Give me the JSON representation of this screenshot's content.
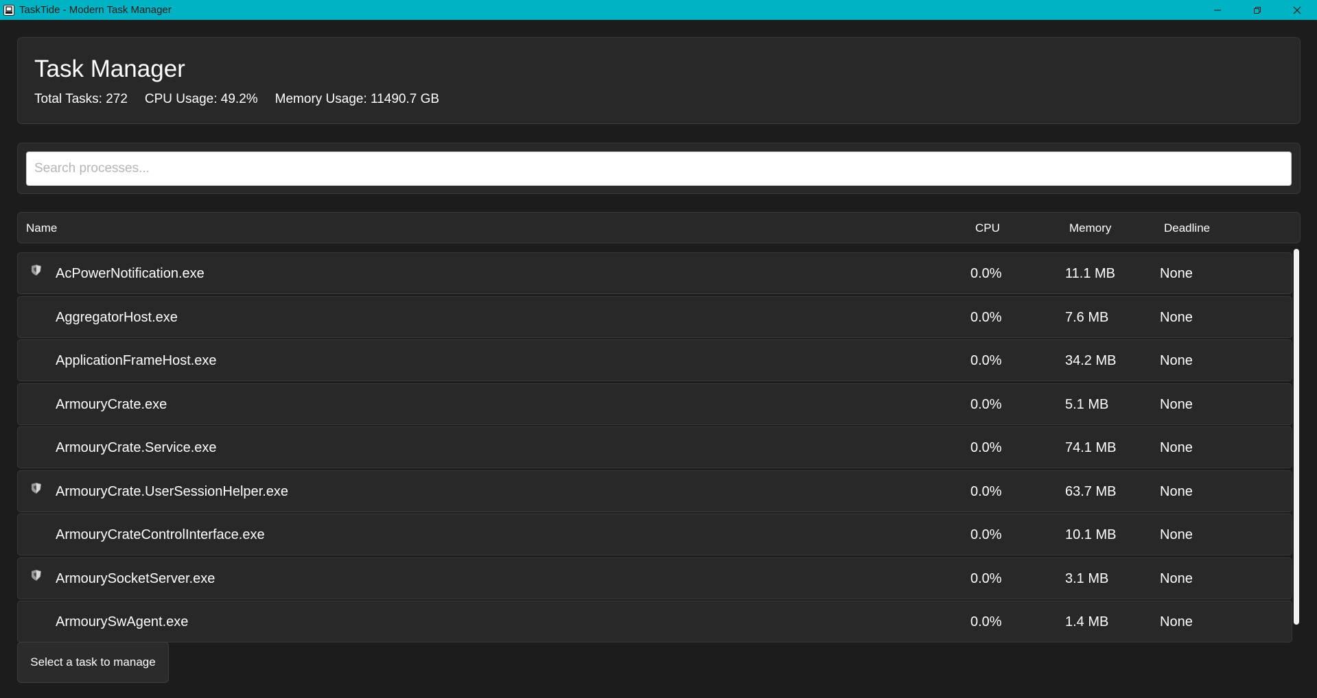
{
  "window": {
    "title": "TaskTide - Modern Task Manager",
    "minimize_icon": "minimize-icon",
    "maximize_icon": "restore-icon",
    "close_icon": "close-icon"
  },
  "header": {
    "title": "Task Manager",
    "total_tasks": "Total Tasks: 272",
    "cpu_usage": "CPU Usage: 49.2%",
    "memory_usage": "Memory Usage: 11490.7 GB"
  },
  "search": {
    "placeholder": "Search processes...",
    "value": ""
  },
  "table": {
    "columns": {
      "name": "Name",
      "cpu": "CPU",
      "memory": "Memory",
      "deadline": "Deadline"
    },
    "rows": [
      {
        "name": "AcPowerNotification.exe",
        "cpu": "0.0%",
        "memory": "11.1 MB",
        "deadline": "None",
        "icon": "shield-icon"
      },
      {
        "name": "AggregatorHost.exe",
        "cpu": "0.0%",
        "memory": "7.6 MB",
        "deadline": "None",
        "icon": ""
      },
      {
        "name": "ApplicationFrameHost.exe",
        "cpu": "0.0%",
        "memory": "34.2 MB",
        "deadline": "None",
        "icon": ""
      },
      {
        "name": "ArmouryCrate.exe",
        "cpu": "0.0%",
        "memory": "5.1 MB",
        "deadline": "None",
        "icon": ""
      },
      {
        "name": "ArmouryCrate.Service.exe",
        "cpu": "0.0%",
        "memory": "74.1 MB",
        "deadline": "None",
        "icon": ""
      },
      {
        "name": "ArmouryCrate.UserSessionHelper.exe",
        "cpu": "0.0%",
        "memory": "63.7 MB",
        "deadline": "None",
        "icon": "shield-icon"
      },
      {
        "name": "ArmouryCrateControlInterface.exe",
        "cpu": "0.0%",
        "memory": "10.1 MB",
        "deadline": "None",
        "icon": ""
      },
      {
        "name": "ArmourySocketServer.exe",
        "cpu": "0.0%",
        "memory": "3.1 MB",
        "deadline": "None",
        "icon": "shield-icon"
      },
      {
        "name": "ArmourySwAgent.exe",
        "cpu": "0.0%",
        "memory": "1.4 MB",
        "deadline": "None",
        "icon": ""
      }
    ]
  },
  "status": {
    "label": "Select a task to manage"
  },
  "colors": {
    "titlebar": "#00b3c4",
    "background": "#1c1c1c",
    "card": "#282828",
    "border": "#3a3a3a"
  }
}
